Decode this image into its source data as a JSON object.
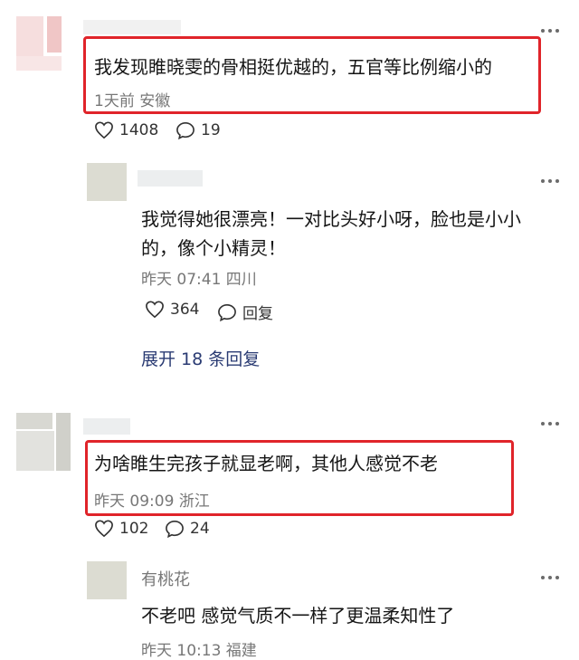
{
  "comments": [
    {
      "text": "我发现睢晓雯的骨相挺优越的，五官等比例缩小的",
      "meta": "1天前 安徽",
      "likes": "1408",
      "replies_count": "19"
    },
    {
      "text_line1": "我觉得她很漂亮！一对比头好小呀，脸也是小小",
      "text_line2": "的，像个小精灵！",
      "meta": "昨天 07:41 四川",
      "likes": "364",
      "reply_label": "回复",
      "expand_label": "展开 18 条回复"
    },
    {
      "text": "为啥睢生完孩子就显老啊，其他人感觉不老",
      "meta": "昨天 09:09 浙江",
      "likes": "102",
      "replies_count": "24"
    },
    {
      "username": "有桃花",
      "text": "不老吧 感觉气质不一样了更温柔知性了",
      "meta": "昨天 10:13 福建"
    }
  ],
  "colors": {
    "highlight_border": "#e0242a",
    "expand_link": "#2a3b73",
    "meta_text": "#777777"
  },
  "icons": [
    "heart-icon",
    "comment-bubble-icon",
    "more-dots-icon"
  ]
}
